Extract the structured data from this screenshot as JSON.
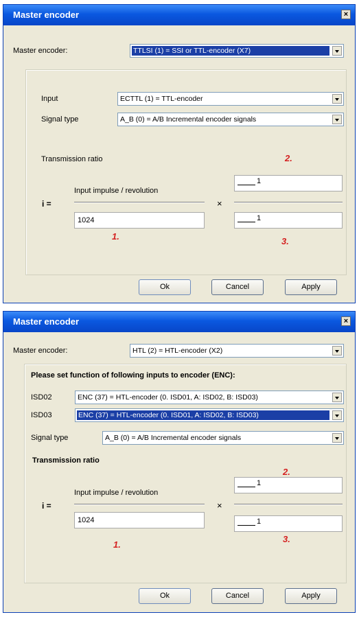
{
  "dialog1": {
    "title": "Master encoder",
    "close": "×",
    "master_label": "Master encoder:",
    "master_value": "TTLSI (1) = SSI or TTL-encoder (X7)",
    "input_label": "Input",
    "input_value": "ECTTL (1) = TTL-encoder",
    "signal_label": "Signal type",
    "signal_value": "A_B (0) = A/B Incremental encoder signals",
    "transmission_label": "Transmission ratio",
    "i_label": "i =",
    "impulse_label": "Input impulse / revolution",
    "impulse_value": "1024",
    "times": "×",
    "num_value": "1",
    "den_value": "1",
    "marker1": "1.",
    "marker2": "2.",
    "marker3": "3.",
    "ok": "Ok",
    "cancel": "Cancel",
    "apply": "Apply"
  },
  "dialog2": {
    "title": "Master encoder",
    "close": "×",
    "master_label": "Master encoder:",
    "master_value": "HTL (2) = HTL-encoder (X2)",
    "instruction": "Please set function of following inputs to encoder (ENC):",
    "isd02_label": "ISD02",
    "isd02_value": "ENC (37) = HTL-encoder (0. ISD01, A: ISD02, B: ISD03)",
    "isd03_label": "ISD03",
    "isd03_value": "ENC (37) = HTL-encoder (0. ISD01, A: ISD02, B: ISD03)",
    "signal_label": "Signal type",
    "signal_value": "A_B (0) = A/B Incremental encoder signals",
    "transmission_label": "Transmission ratio",
    "i_label": "i =",
    "impulse_label": "Input impulse / revolution",
    "impulse_value": "1024",
    "times": "×",
    "num_value": "1",
    "den_value": "1",
    "marker1": "1.",
    "marker2": "2.",
    "marker3": "3.",
    "ok": "Ok",
    "cancel": "Cancel",
    "apply": "Apply"
  }
}
